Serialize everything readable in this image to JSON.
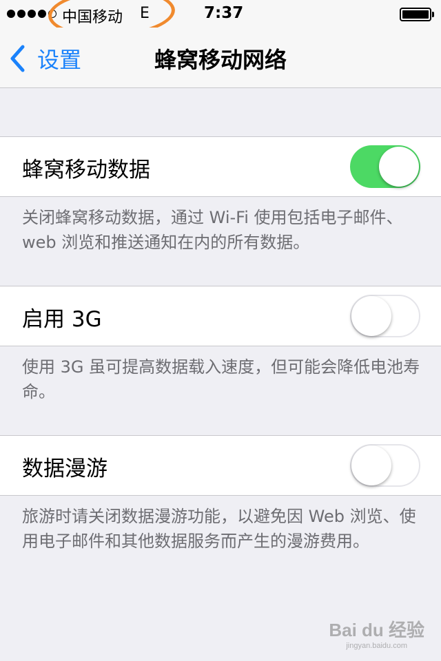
{
  "status_bar": {
    "carrier": "中国移动",
    "network": "E",
    "time": "7:37",
    "signal_bars_filled": 4,
    "signal_bars_total": 5
  },
  "nav": {
    "back_label": "设置",
    "title": "蜂窝移动网络"
  },
  "settings": [
    {
      "label": "蜂窝移动数据",
      "toggle_on": true,
      "footnote": "关闭蜂窝移动数据，通过 Wi-Fi 使用包括电子邮件、web 浏览和推送通知在内的所有数据。"
    },
    {
      "label": "启用 3G",
      "toggle_on": false,
      "footnote": "使用 3G 虽可提高数据载入速度，但可能会降低电池寿命。"
    },
    {
      "label": "数据漫游",
      "toggle_on": false,
      "footnote": "旅游时请关闭数据漫游功能，以避免因 Web 浏览、使用电子邮件和其他数据服务而产生的漫游费用。"
    }
  ],
  "watermark": {
    "text": "Bai du 经验",
    "sub": "jingyan.baidu.com"
  },
  "colors": {
    "accent": "#1a82fb",
    "toggle_on": "#4cd964",
    "annotation": "#f08a2e",
    "background": "#efeff4"
  }
}
